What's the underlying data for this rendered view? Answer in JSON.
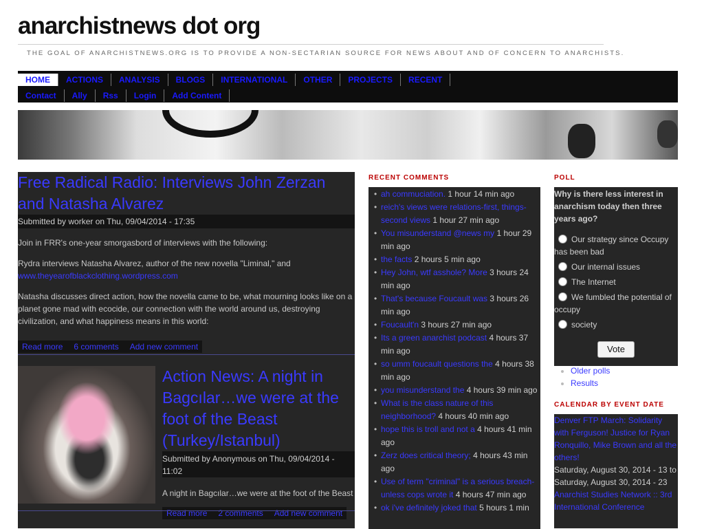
{
  "site": {
    "title": "anarchistnews dot org",
    "slogan": "THE GOAL OF ANARCHISTNEWS.ORG IS TO PROVIDE A NON-SECTARIAN SOURCE FOR NEWS ABOUT AND OF CONCERN TO ANARCHISTS."
  },
  "nav": {
    "primary": [
      "HOME",
      "ACTIONS",
      "ANALYSIS",
      "BLOGS",
      "INTERNATIONAL",
      "OTHER",
      "PROJECTS",
      "RECENT"
    ],
    "secondary": [
      "Contact",
      "Ally",
      "Rss",
      "Login",
      "Add Content"
    ],
    "active": "HOME"
  },
  "posts": [
    {
      "title": "Free Radical Radio: Interviews John Zerzan and Natasha Alvarez",
      "submitted": "Submitted by worker on Thu, 09/04/2014 - 17:35",
      "body": [
        "Join in FRR's one-year smorgasbord of interviews with the following:",
        "Rydra interviews Natasha Alvarez, author of the new novella \"Liminal,\" and",
        "www.theyearofblackclothing.wordpress.com",
        "Natasha discusses direct action, how the novella came to be, what mourning looks like on a planet gone mad with ecocide, our connection with the world around us, destroying civilization, and what happiness means in this world:"
      ],
      "links": [
        "Read more",
        "6 comments",
        "Add new comment"
      ]
    },
    {
      "title": "Action News: A night in Bagcılar…we were at the foot of the Beast (Turkey/Istanbul)",
      "submitted": "Submitted by Anonymous on Thu, 09/04/2014 - 11:02",
      "body": [
        "A night in Bagcılar…we were at the foot of the Beast"
      ],
      "links": [
        "Read more",
        "2 comments",
        "Add new comment"
      ]
    }
  ],
  "recent_comments": {
    "heading": "RECENT COMMENTS",
    "items": [
      {
        "link": "ah commuciation.",
        "time": "1 hour 14 min ago"
      },
      {
        "link": "reich's views were relations-first, things-second views",
        "time": "1 hour 27 min ago"
      },
      {
        "link": "You misunderstand @news my",
        "time": "1 hour 29 min ago"
      },
      {
        "link": "the facts",
        "time": "2 hours 5 min ago"
      },
      {
        "link": "Hey John, wtf asshole? More",
        "time": "3 hours 24 min ago"
      },
      {
        "link": "That's because Foucault was",
        "time": "3 hours 26 min ago"
      },
      {
        "link": "Foucault'n",
        "time": "3 hours 27 min ago"
      },
      {
        "link": "Its a green anarchist podcast",
        "time": "4 hours 37 min ago"
      },
      {
        "link": "so umm foucault questions the",
        "time": "4 hours 38 min ago"
      },
      {
        "link": "you misunderstand the",
        "time": "4 hours 39 min ago"
      },
      {
        "link": "What is the class nature of this neighborhood?",
        "time": "4 hours 40 min ago"
      },
      {
        "link": "hope this is troll and not a",
        "time": "4 hours 41 min ago"
      },
      {
        "link": "Zerz does critical theory;",
        "time": "4 hours 43 min ago"
      },
      {
        "link": "Use of term \"criminal\" is a serious breach-unless cops wrote it",
        "time": "4 hours 47 min ago"
      },
      {
        "link": "ok i've definitely joked that",
        "time": "5 hours 1 min"
      }
    ]
  },
  "poll": {
    "heading": "POLL",
    "question": "Why is there less interest in anarchism today then three years ago?",
    "options": [
      "Our strategy since Occupy has been bad",
      "Our internal issues",
      "The Internet",
      "We fumbled the potential of occupy",
      "society"
    ],
    "vote_label": "Vote",
    "links": [
      "Older polls",
      "Results"
    ]
  },
  "calendar": {
    "heading": "CALENDAR BY EVENT DATE",
    "events": [
      {
        "title": "Denver FTP March: Solidarity with Ferguson! Justice for Ryan Ronquillo, Mike Brown and all the others!",
        "dates": "Saturday, August 30, 2014 - 13 to Saturday, August 30, 2014 - 23"
      },
      {
        "title": "Anarchist Studies Network :: 3rd International Conference",
        "dates": ""
      }
    ]
  }
}
